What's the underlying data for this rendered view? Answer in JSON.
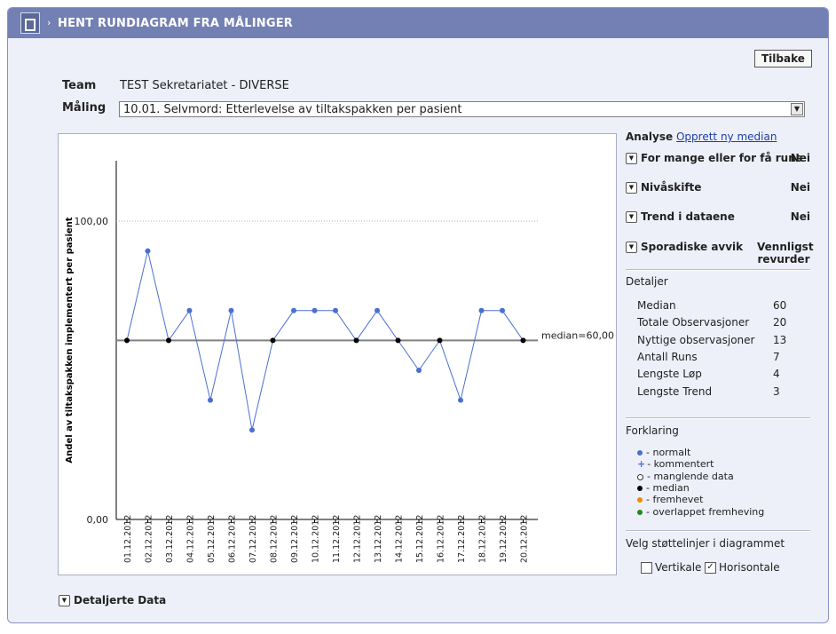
{
  "header": {
    "title": "HENT RUNDIAGRAM FRA MÅLINGER",
    "icon": "building-icon"
  },
  "back_button": "Tilbake",
  "team": {
    "label": "Team",
    "value": "TEST Sekretariatet - DIVERSE"
  },
  "measure": {
    "label": "Måling",
    "selected": "10.01. Selvmord: Etterlevelse av tiltakspakken per pasient"
  },
  "chart_data": {
    "type": "line",
    "ylabel": "Andel av tiltakspakken implementert per pasient",
    "xlabel": "",
    "ylim": [
      0,
      100
    ],
    "yticks": [
      "0,00",
      "100,00"
    ],
    "categories": [
      "01.12.2012",
      "02.12.2012",
      "03.12.2012",
      "04.12.2012",
      "05.12.2012",
      "06.12.2012",
      "07.12.2012",
      "08.12.2012",
      "09.12.2012",
      "10.12.2012",
      "11.12.2012",
      "12.12.2012",
      "13.12.2012",
      "14.12.2012",
      "15.12.2012",
      "16.12.2012",
      "17.12.2012",
      "18.12.2012",
      "19.12.2012",
      "20.12.2012"
    ],
    "values": [
      60,
      90,
      60,
      70,
      40,
      70,
      30,
      60,
      70,
      70,
      70,
      60,
      70,
      60,
      50,
      60,
      40,
      70,
      70,
      60
    ],
    "median": 60,
    "median_label": "median=60,00",
    "horizontal_gridline_at": 100,
    "colors": {
      "normal": "#4a6fd0",
      "median": "#000000",
      "line": "#4a6fd0",
      "median_line": "#808080"
    }
  },
  "analysis": {
    "heading": "Analyse",
    "new_median_link": "Opprett ny median",
    "items": [
      {
        "label": "For mange eller for få runs",
        "value": "Nei"
      },
      {
        "label": "Nivåskifte",
        "value": "Nei"
      },
      {
        "label": "Trend i dataene",
        "value": "Nei"
      },
      {
        "label": "Sporadiske avvik",
        "value": "Vennligst revurder"
      }
    ]
  },
  "details": {
    "heading": "Detaljer",
    "rows": [
      {
        "label": "Median",
        "value": "60"
      },
      {
        "label": "Totale Observasjoner",
        "value": "20"
      },
      {
        "label": "Nyttige observasjoner",
        "value": "13"
      },
      {
        "label": "Antall Runs",
        "value": "7"
      },
      {
        "label": "Lengste Løp",
        "value": "4"
      },
      {
        "label": "Lengste Trend",
        "value": "3"
      }
    ]
  },
  "legend": {
    "heading": "Forklaring",
    "items": [
      {
        "label": "- normalt",
        "color": "#4a6fd0",
        "shape": "dot"
      },
      {
        "label": "- kommentert",
        "color": "#4a6fd0",
        "shape": "plus"
      },
      {
        "label": "- manglende data",
        "color": "#ffffff",
        "shape": "ring"
      },
      {
        "label": "- median",
        "color": "#000000",
        "shape": "dot"
      },
      {
        "label": "- fremhevet",
        "color": "#f08a00",
        "shape": "dot"
      },
      {
        "label": "- overlappet fremheving",
        "color": "#1f8a1f",
        "shape": "dot"
      }
    ]
  },
  "support_lines": {
    "heading": "Velg støttelinjer i diagrammet",
    "vertical": {
      "label": "Vertikale",
      "checked": false
    },
    "horizontal": {
      "label": "Horisontale",
      "checked": true
    }
  },
  "detailed_data": {
    "label": "Detaljerte Data"
  }
}
